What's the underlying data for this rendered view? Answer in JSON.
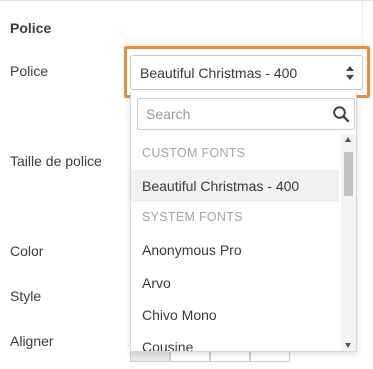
{
  "section": {
    "title": "Police"
  },
  "labels": {
    "police": "Police",
    "taille": "Taille de police",
    "color": "Color",
    "style": "Style",
    "aligner": "Aligner"
  },
  "font_select": {
    "value": "Beautiful Christmas - 400",
    "highlight_color": "#ef8a3a"
  },
  "dropdown": {
    "search_placeholder": "Search",
    "groups": [
      {
        "header": "CUSTOM FONTS",
        "options": [
          "Beautiful Christmas - 400"
        ]
      },
      {
        "header": "SYSTEM FONTS",
        "options": [
          "Anonymous Pro",
          "Arvo",
          "Chivo Mono",
          "Cousine"
        ]
      }
    ],
    "selected": "Beautiful Christmas - 400"
  },
  "icons": {
    "select_arrows": "updown-arrows-icon",
    "search": "search-icon"
  }
}
